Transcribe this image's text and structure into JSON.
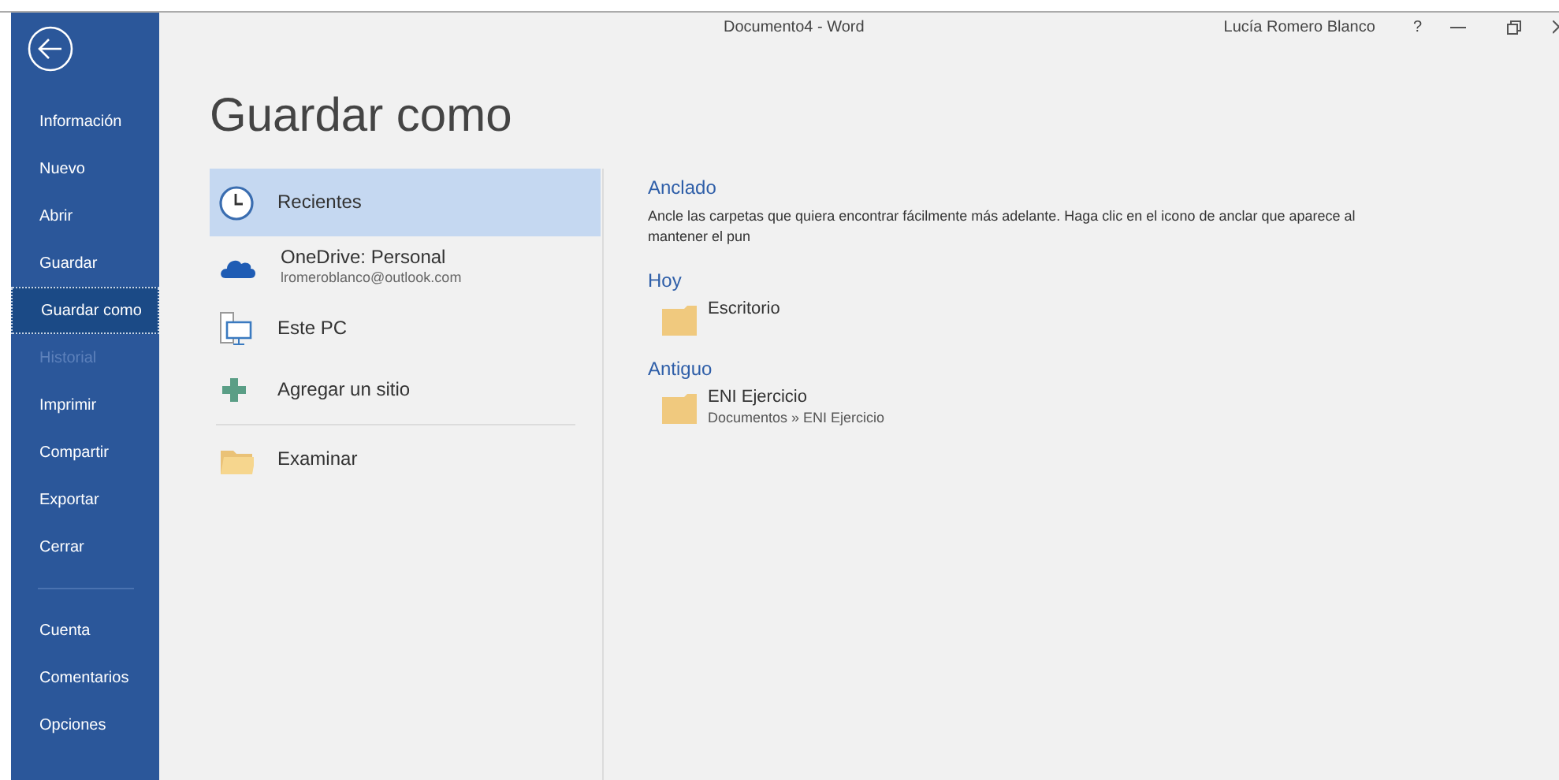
{
  "window": {
    "title": "Documento4  -  Word",
    "user": "Lucía Romero Blanco",
    "help": "?"
  },
  "sidebar": {
    "sections": [
      {
        "items": [
          {
            "label": "Información",
            "selected": false,
            "disabled": false
          },
          {
            "label": "Nuevo",
            "selected": false,
            "disabled": false
          },
          {
            "label": "Abrir",
            "selected": false,
            "disabled": false
          },
          {
            "label": "Guardar",
            "selected": false,
            "disabled": false
          },
          {
            "label": "Guardar como",
            "selected": true,
            "disabled": false
          },
          {
            "label": "Historial",
            "selected": false,
            "disabled": true
          },
          {
            "label": "Imprimir",
            "selected": false,
            "disabled": false
          },
          {
            "label": "Compartir",
            "selected": false,
            "disabled": false
          },
          {
            "label": "Exportar",
            "selected": false,
            "disabled": false
          },
          {
            "label": "Cerrar",
            "selected": false,
            "disabled": false
          }
        ]
      },
      {
        "items": [
          {
            "label": "Cuenta",
            "selected": false,
            "disabled": false
          },
          {
            "label": "Comentarios",
            "selected": false,
            "disabled": false
          },
          {
            "label": "Opciones",
            "selected": false,
            "disabled": false
          }
        ]
      }
    ]
  },
  "page_title": "Guardar como",
  "places": [
    {
      "kind": "clock",
      "label": "Recientes",
      "selected": true
    },
    {
      "kind": "cloud",
      "label": "OneDrive: Personal",
      "detail": "lromeroblanco@outlook.com",
      "selected": false
    },
    {
      "kind": "pc",
      "label": "Este PC",
      "selected": false
    },
    {
      "kind": "plus",
      "label": "Agregar un sitio",
      "selected": false
    },
    {
      "kind": "folder",
      "label": "Examinar",
      "selected": false
    }
  ],
  "pinned": {
    "heading": "Anclado",
    "text": "Ancle las carpetas que quiera encontrar fácilmente más adelante. Haga clic en el icono de anclar que aparece al mantener el pun"
  },
  "groups": [
    {
      "heading": "Hoy",
      "folders": [
        {
          "name": "Escritorio"
        }
      ]
    },
    {
      "heading": "Antiguo",
      "folders": [
        {
          "name": "ENI Ejercicio",
          "path": "Documentos » ENI Ejercicio"
        }
      ]
    }
  ]
}
